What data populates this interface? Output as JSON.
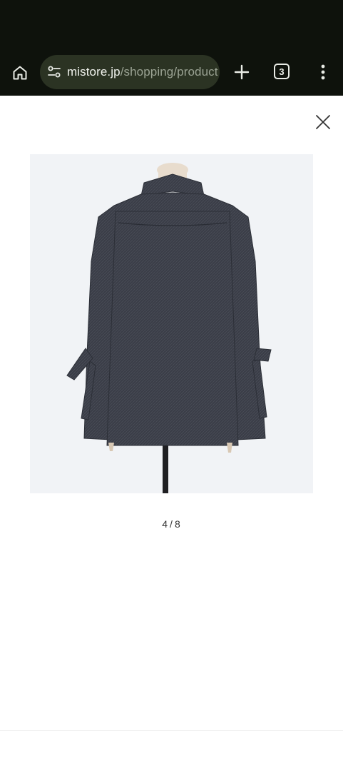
{
  "browser": {
    "url_domain": "mistore.jp",
    "url_path": "/shopping/product",
    "tab_count": "3",
    "icons": {
      "home": "home-icon",
      "site_settings": "tune-icon",
      "new_tab": "plus-icon",
      "menu": "more-vert-icon"
    },
    "colors": {
      "toolbar_bg": "#0e120c",
      "urlbar_bg": "#2b3323"
    }
  },
  "viewer": {
    "close_icon": "close-icon",
    "current": "4",
    "separator": "/",
    "total": "8",
    "image_bg": "#f1f3f6"
  }
}
